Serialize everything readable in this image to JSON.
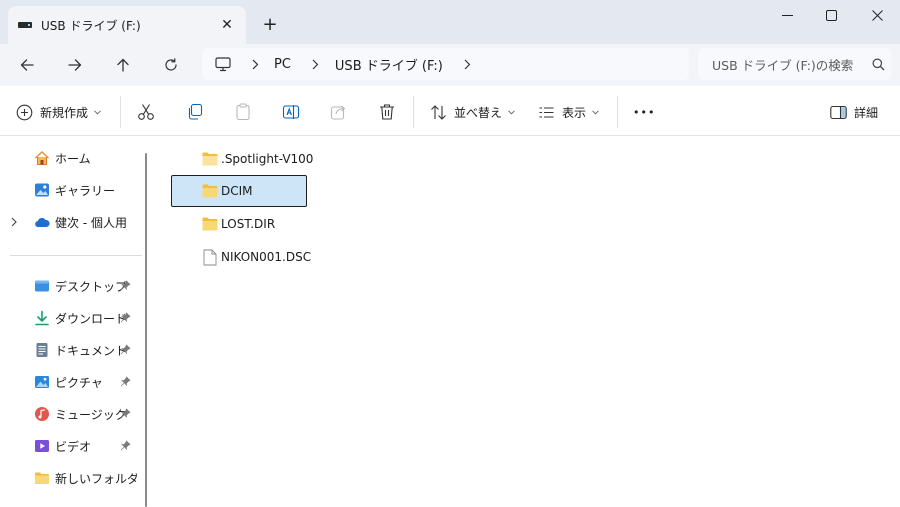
{
  "window": {
    "tab_title": "USB ドライブ (F:)",
    "tab_close": "✕",
    "new_tab": "+",
    "minimize": "—",
    "maximize": "☐",
    "close": "✕"
  },
  "address": {
    "crumbs": [
      "PC",
      "USB ドライブ (F:)"
    ],
    "search_placeholder": "USB ドライブ (F:)の検索"
  },
  "toolbar": {
    "new_label": "新規作成",
    "sort_label": "並べ替え",
    "view_label": "表示",
    "more_label": "•••",
    "details_label": "詳細"
  },
  "sidebar": {
    "items": [
      {
        "label": "ホーム",
        "icon": "home-icon"
      },
      {
        "label": "ギャラリー",
        "icon": "gallery-icon"
      },
      {
        "label": "健次 - 個人用",
        "icon": "onedrive-icon"
      },
      {
        "label": "デスクトップ",
        "icon": "desktop-icon"
      },
      {
        "label": "ダウンロード",
        "icon": "download-icon"
      },
      {
        "label": "ドキュメント",
        "icon": "documents-icon"
      },
      {
        "label": "ピクチャ",
        "icon": "pictures-icon"
      },
      {
        "label": "ミュージック",
        "icon": "music-icon"
      },
      {
        "label": "ビデオ",
        "icon": "videos-icon"
      },
      {
        "label": "新しいフォルダー (",
        "icon": "folder-icon"
      }
    ]
  },
  "files": {
    "items": [
      {
        "name": ".Spotlight-V100",
        "type": "folder"
      },
      {
        "name": "DCIM",
        "type": "folder",
        "selected": true
      },
      {
        "name": "LOST.DIR",
        "type": "folder"
      },
      {
        "name": "NIKON001.DSC",
        "type": "file"
      }
    ]
  },
  "colors": {
    "accent": "#0067c0",
    "selection": "#cde5f7",
    "folder": "#f8d775",
    "titlebar": "#e3e8f1"
  }
}
